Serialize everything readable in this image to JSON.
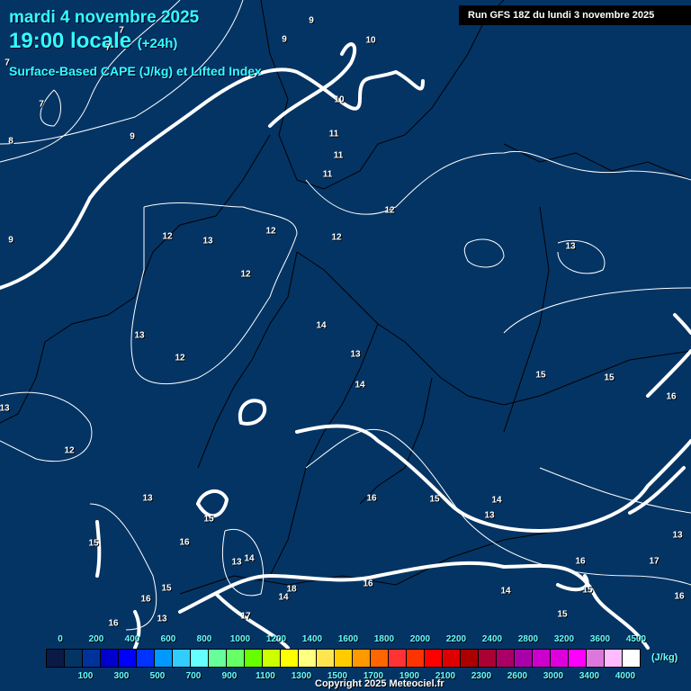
{
  "header": {
    "date": "mardi 4 novembre 2025",
    "time": "19:00 locale",
    "lead": "(+24h)",
    "product": "Surface-Based CAPE (J/kg) et Lifted Index",
    "run": "Run GFS 18Z du lundi 3 novembre 2025"
  },
  "contour_labels": [
    "9",
    "9",
    "10",
    "7",
    "7",
    "7",
    "7",
    "8",
    "9",
    "10",
    "11",
    "11",
    "11",
    "12",
    "12",
    "12",
    "13",
    "12",
    "12",
    "9",
    "13",
    "13",
    "14",
    "13",
    "12",
    "14",
    "13",
    "15",
    "15",
    "16",
    "12",
    "13",
    "15",
    "15",
    "16",
    "15",
    "14",
    "13",
    "16",
    "13",
    "13",
    "14",
    "15",
    "16",
    "17",
    "18",
    "14",
    "16",
    "17",
    "16",
    "13",
    "14",
    "15",
    "16",
    "15",
    "16"
  ],
  "legend": {
    "colors": [
      "#0a1a44",
      "#043464",
      "#003399",
      "#0000cc",
      "#0000ff",
      "#0033ff",
      "#0099ff",
      "#33ccff",
      "#66ffff",
      "#66ff99",
      "#66ff66",
      "#66ff00",
      "#ccff00",
      "#ffff00",
      "#ffff80",
      "#ffe650",
      "#ffcc00",
      "#ff9900",
      "#ff6600",
      "#ff3333",
      "#ff3300",
      "#ff0000",
      "#dd0000",
      "#aa0000",
      "#aa0033",
      "#aa0066",
      "#aa00aa",
      "#cc00cc",
      "#dd00dd",
      "#ff00ff",
      "#dd77dd",
      "#ffbbff",
      "#ffffff"
    ],
    "top_labels": [
      "0",
      "200",
      "400",
      "600",
      "800",
      "1000",
      "1200",
      "1400",
      "1600",
      "1800",
      "2000",
      "2200",
      "2400",
      "2800",
      "3200",
      "3600",
      "4500"
    ],
    "bottom_labels": [
      "100",
      "300",
      "500",
      "700",
      "900",
      "1100",
      "1300",
      "1500",
      "1700",
      "1900",
      "2100",
      "2300",
      "2600",
      "3000",
      "3400",
      "4000"
    ],
    "unit": "(J/kg)"
  },
  "copyright": "Copyright 2025 Meteociel.fr"
}
